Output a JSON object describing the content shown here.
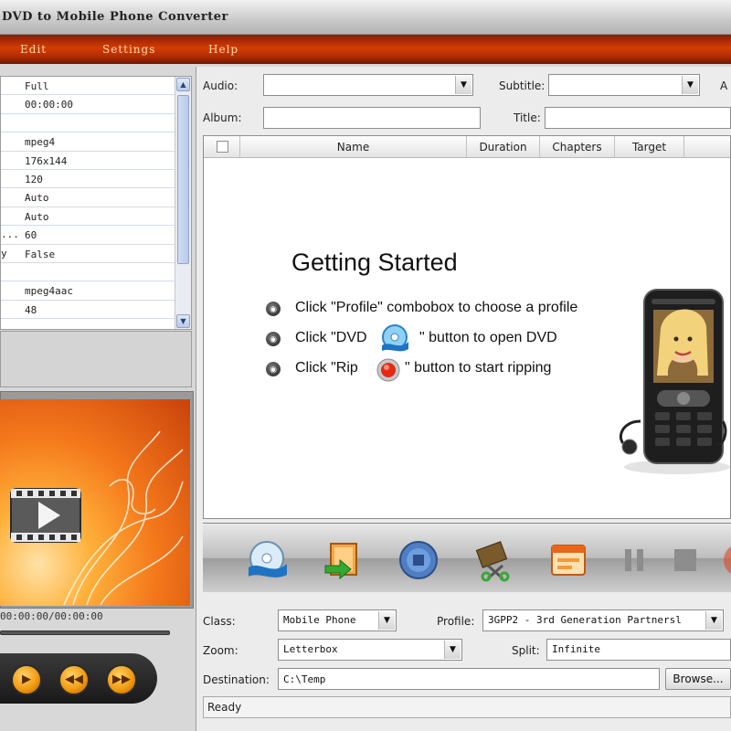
{
  "window": {
    "title": "DVD to Mobile Phone Converter"
  },
  "menu": [
    "Edit",
    "Settings",
    "Help"
  ],
  "properties": [
    {
      "key": "",
      "value": "Full"
    },
    {
      "key": "",
      "value": "00:00:00"
    },
    {
      "key": "",
      "value": ""
    },
    {
      "key": "",
      "value": "mpeg4"
    },
    {
      "key": "",
      "value": "176x144"
    },
    {
      "key": "",
      "value": "120"
    },
    {
      "key": "",
      "value": "Auto"
    },
    {
      "key": "",
      "value": "Auto"
    },
    {
      "key": "...",
      "value": "60"
    },
    {
      "key": "y",
      "value": "False"
    },
    {
      "key": "",
      "value": ""
    },
    {
      "key": "",
      "value": "mpeg4aac"
    },
    {
      "key": "",
      "value": "48"
    }
  ],
  "preview": {
    "timecode": "00:00:00/00:00:00"
  },
  "top_fields": {
    "audio_label": "Audio:",
    "subtitle_label": "Subtitle:",
    "extra_label": "A",
    "album_label": "Album:",
    "title_label": "Title:"
  },
  "columns": [
    "Name",
    "Duration",
    "Chapters",
    "Target"
  ],
  "getting_started": {
    "title": "Getting Started",
    "steps": [
      {
        "before": "Click \"Profile\" combobox to choose a profile",
        "after": ""
      },
      {
        "before": "Click \"DVD",
        "after": "\" button to open DVD"
      },
      {
        "before": "Click \"Rip",
        "after": "\" button to start ripping"
      }
    ]
  },
  "toolbar_icons": [
    "open-dvd-icon",
    "open-folder-icon",
    "stop-icon",
    "clip-icon",
    "settings-window-icon",
    "pause-icon",
    "stop-square-icon",
    "rip-icon"
  ],
  "output": {
    "class_label": "Class:",
    "class_value": "Mobile Phone",
    "profile_label": "Profile:",
    "profile_value": "3GPP2 - 3rd Generation Partnersl",
    "zoom_label": "Zoom:",
    "zoom_value": "Letterbox",
    "split_label": "Split:",
    "split_value": "Infinite",
    "destination_label": "Destination:",
    "destination_value": "C:\\Temp",
    "browse_label": "Browse..."
  },
  "status": "Ready",
  "colors": {
    "accent": "#d33d05",
    "player_button": "#f29c13"
  }
}
